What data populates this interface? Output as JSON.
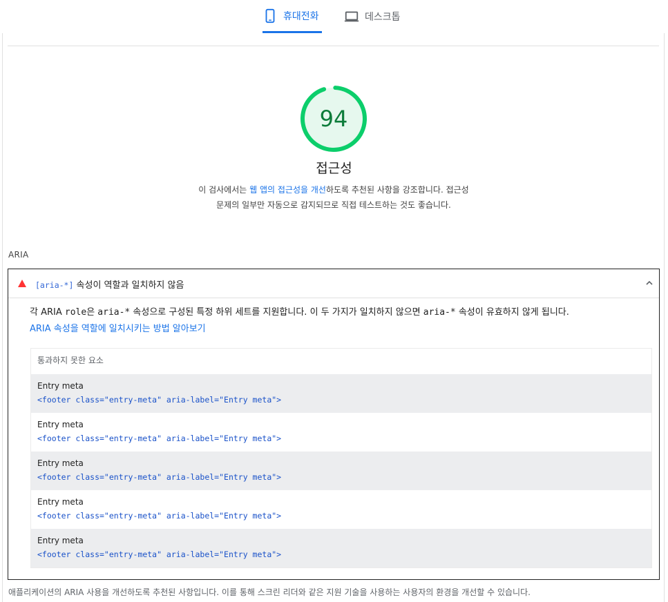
{
  "tabs": [
    {
      "label": "휴대전화",
      "icon": "smartphone-icon",
      "active": true
    },
    {
      "label": "데스크톱",
      "icon": "laptop-icon",
      "active": false
    }
  ],
  "score": {
    "value": "94",
    "fraction": 0.94,
    "ring_color": "#0cce6b",
    "fill_color": "#e6f8ee",
    "text_color": "#0d7c3a"
  },
  "category": {
    "title": "접근성",
    "desc_prefix": "이 검사에서는 ",
    "desc_link": "웹 앱의 접근성을 개선",
    "desc_suffix": "하도록 추천된 사항을 강조합니다. 접근성 문제의 일부만 자동으로 감지되므로 직접 테스트하는 것도 좋습니다."
  },
  "group": {
    "label": "ARIA"
  },
  "audit": {
    "status_color": "#ff3333",
    "title_code": "[aria-*]",
    "title_text": " 속성이 역할과 일치하지 않음",
    "desc_prefix": "각 ARIA ",
    "desc_code_role": "role",
    "desc_mid": "은 ",
    "desc_code_aria": "aria-*",
    "desc_mid2": " 속성으로 구성된 특정 하위 세트를 지원합니다. 이 두 가지가 일치하지 않으면 ",
    "desc_code_aria2": "aria-*",
    "desc_suffix": " 속성이 유효하지 않게 됩니다.",
    "learn_more": "ARIA 속성을 역할에 일치시키는 방법 알아보기",
    "table_header": "통과하지 못한 요소",
    "rows": [
      {
        "label": "Entry meta",
        "code": "<footer class=\"entry-meta\" aria-label=\"Entry meta\">"
      },
      {
        "label": "Entry meta",
        "code": "<footer class=\"entry-meta\" aria-label=\"Entry meta\">"
      },
      {
        "label": "Entry meta",
        "code": "<footer class=\"entry-meta\" aria-label=\"Entry meta\">"
      },
      {
        "label": "Entry meta",
        "code": "<footer class=\"entry-meta\" aria-label=\"Entry meta\">"
      },
      {
        "label": "Entry meta",
        "code": "<footer class=\"entry-meta\" aria-label=\"Entry meta\">"
      }
    ]
  },
  "footer_note": "애플리케이션의 ARIA 사용을 개선하도록 추천된 사항입니다. 이를 통해 스크린 리더와 같은 지원 기술을 사용하는 사용자의 환경을 개선할 수 있습니다."
}
